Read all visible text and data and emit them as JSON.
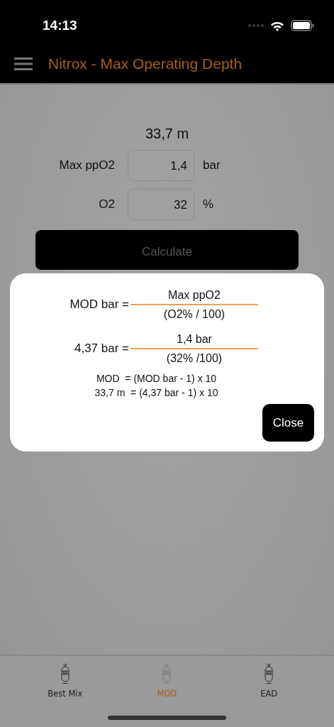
{
  "status_bar": {
    "time": "14:13"
  },
  "nav_bar": {
    "title": "Nitrox - Max Operating Depth"
  },
  "result": "33,7 m",
  "inputs": [
    {
      "label": "Max ppO2",
      "value": "1,4",
      "unit": "bar"
    },
    {
      "label": "O2",
      "value": "32",
      "unit": "%"
    }
  ],
  "calculate_button": "Calculate",
  "dialog": {
    "fractions": [
      {
        "left": "MOD bar =",
        "numerator": "Max ppO2",
        "denominator": "(O2% / 100)"
      },
      {
        "left": "4,37 bar =",
        "numerator": "1,4 bar",
        "denominator": "(32% /100)"
      }
    ],
    "lines": [
      "MOD  = (MOD bar - 1) x 10",
      "33,7 m  = (4,37 bar - 1) x 10"
    ],
    "close_button": "Close"
  },
  "tab_bar": [
    {
      "label": "Best Mix",
      "selected": false
    },
    {
      "label": "MOD",
      "selected": true
    },
    {
      "label": "EAD",
      "selected": false
    }
  ]
}
